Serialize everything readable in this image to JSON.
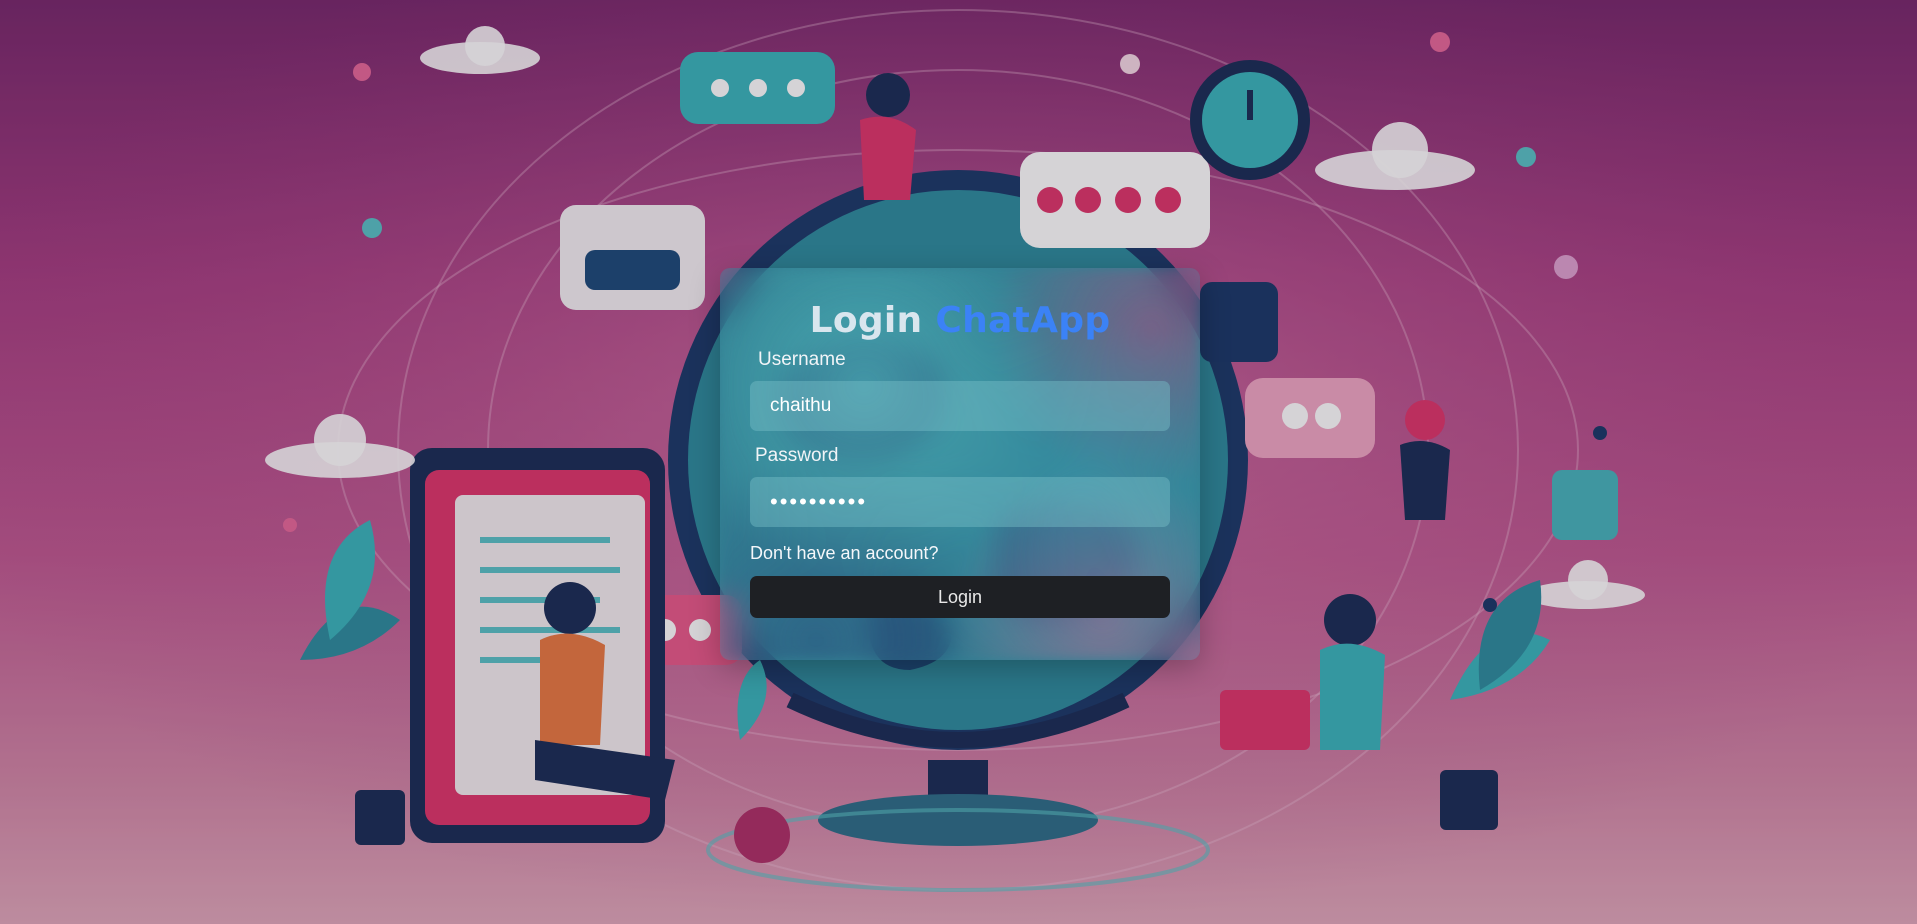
{
  "login": {
    "title_main": "Login",
    "title_accent": "ChatApp",
    "username_label": "Username",
    "username_value": "chaithu",
    "password_label": "Password",
    "password_value": "••••••••••",
    "signup_link": "Don't have an account?",
    "login_button": "Login"
  },
  "colors": {
    "accent": "#3b82f6",
    "button_bg": "#1e2024",
    "background_top": "#7a2a6e",
    "background_bottom": "#e2a9bc"
  },
  "background": {
    "illustration": "chat-app-illustration: people with laptops and phones around a globe, chat bubbles, icons"
  }
}
